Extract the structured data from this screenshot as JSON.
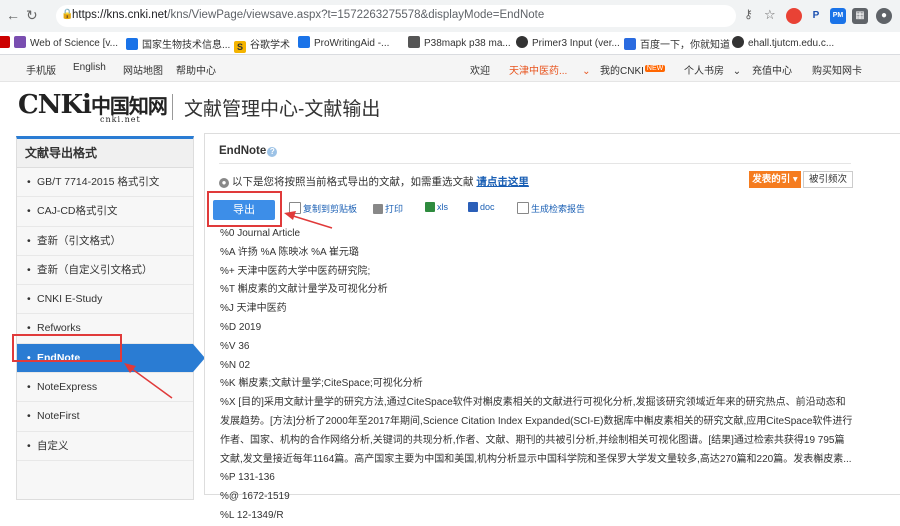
{
  "browser": {
    "url_host": "https://kns.cnki.net",
    "url_rest": "/kns/ViewPage/viewsave.aspx?t=1572263275578&displayMode=EndNote",
    "bookmarks": [
      "Web of Science [v...",
      "国家生物技术信息...",
      "谷歌学术",
      "ProWritingAid -...",
      "P38mapk p38 ma...",
      "Primer3 Input (ver...",
      "百度一下，你就知道",
      "ehall.tjutcm.edu.c..."
    ]
  },
  "topnav": {
    "left": [
      "手机版",
      "English",
      "网站地图",
      "帮助中心"
    ],
    "welcome": "欢迎",
    "org": "天津中医药...",
    "my_cnki": "我的CNKI",
    "new_badge": "NEW",
    "personal": "个人书房",
    "recharge": "充值中心",
    "buy_card": "购买知网卡"
  },
  "header": {
    "logo_cn": "中国知网",
    "logo_sub": "cnki.net",
    "title": "文献管理中心-文献输出"
  },
  "sidebar": {
    "title": "文献导出格式",
    "items": [
      "GB/T 7714-2015 格式引文",
      "CAJ-CD格式引文",
      "查新（引文格式）",
      "查新（自定义引文格式）",
      "CNKI E-Study",
      "Refworks",
      "EndNote",
      "NoteExpress",
      "NoteFirst",
      "自定义"
    ],
    "active_index": 6
  },
  "main": {
    "title": "EndNote",
    "notice_text": "以下是您将按照当前格式导出的文献，如需重选文献",
    "notice_link": "请点击这里",
    "orange_btn": "发表的引 ▾",
    "cite_btn": "被引频次",
    "export_btn": "导出",
    "toolbar": [
      "复制到剪贴板",
      "打印",
      "xls",
      "doc",
      "生成检索报告"
    ],
    "lines": [
      "%0 Journal Article",
      "%A 许扬 %A 陈映冰 %A 崔元璐",
      "%+ 天津中医药大学中医药研究院;",
      "%T 槲皮素的文献计量学及可视化分析",
      "%J 天津中医药",
      "%D 2019",
      "%V 36",
      "%N 02",
      "%K 槲皮素;文献计量学;CiteSpace;可视化分析",
      "%X [目的]采用文献计量学的研究方法,通过CiteSpace软件对槲皮素相关的文献进行可视化分析,发掘该研究领域近年来的研究热点、前沿动态和",
      "发展趋势。[方法]分析了2000年至2017年期间,Science Citation Index Expanded(SCI-E)数据库中槲皮素相关的研究文献,应用CiteSpace软件进行",
      "作者、国家、机构的合作网络分析,关键词的共现分析,作者、文献、期刊的共被引分析,并绘制相关可视化图谱。[结果]通过检索共获得19 795篇",
      "文献,发文量接近每年1164篇。高产国家主要为中国和美国,机构分析显示中国科学院和圣保罗大学发文量较多,高达270篇和220篇。发表槲皮素...",
      "%P 131-136",
      "%@ 1672-1519",
      "%L 12-1349/R"
    ]
  },
  "colors": {
    "accent": "#2a7cd3",
    "highlight": "#e03a3a",
    "orange": "#f57c1f"
  }
}
